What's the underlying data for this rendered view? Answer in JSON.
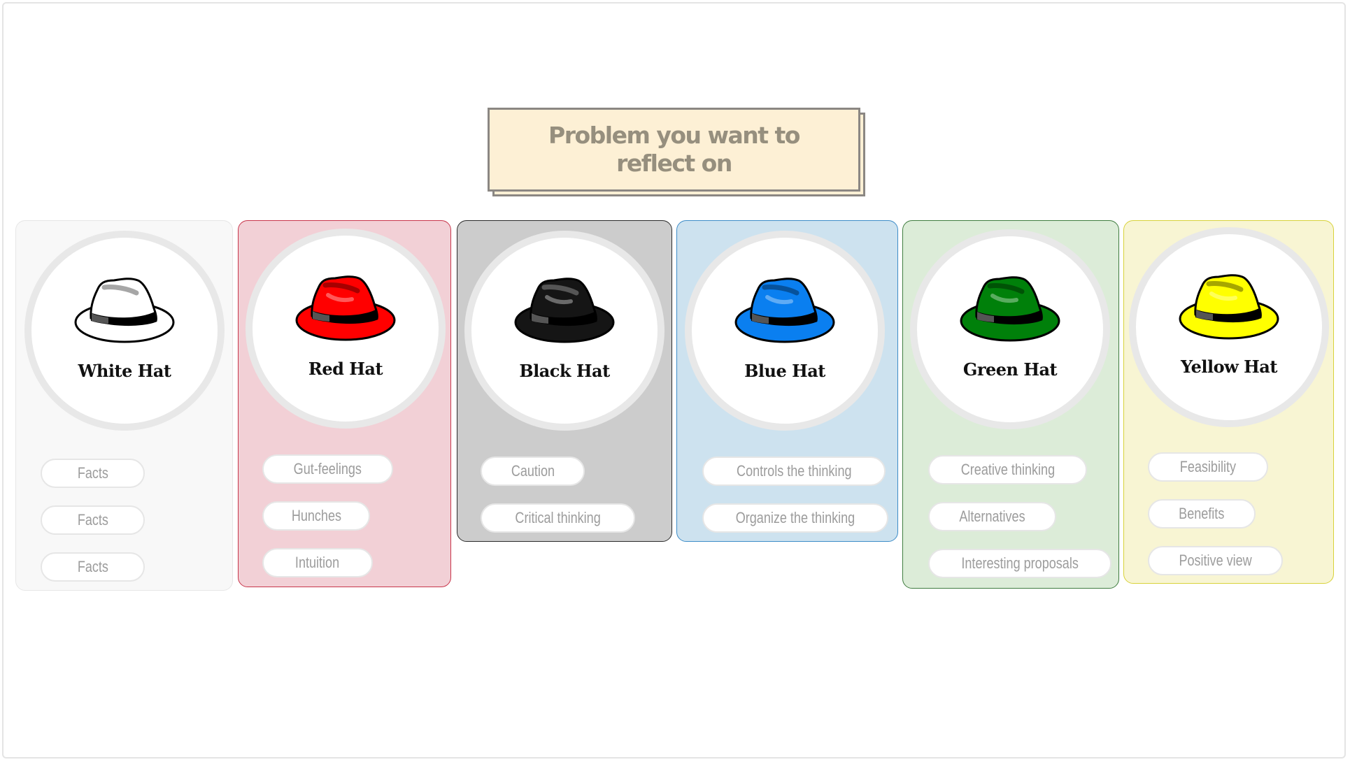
{
  "title": "Problem you want to reflect on",
  "colors": {
    "frame_border": "#e4e4e4",
    "title_fill": "#fdf0d5",
    "title_border": "#8b8783",
    "title_text": "#968f7e",
    "pill_text": "#9c9c9c"
  },
  "hats": [
    {
      "label": "White Hat",
      "icon": "white-hat-icon",
      "hat_color": "#ffffff",
      "card_bg": "#f8f8f8",
      "card_border": "#e6e6e6",
      "items": [
        "Facts",
        "Facts",
        "Facts"
      ]
    },
    {
      "label": "Red Hat",
      "icon": "red-hat-icon",
      "hat_color": "#ff0000",
      "card_bg": "#f2d0d6",
      "card_border": "#c8354b",
      "items": [
        "Gut-feelings",
        "Hunches",
        "Intuition"
      ]
    },
    {
      "label": "Black Hat",
      "icon": "black-hat-icon",
      "hat_color": "#151515",
      "card_bg": "#cccccc",
      "card_border": "#2b2b2b",
      "items": [
        "Caution",
        "Critical thinking"
      ]
    },
    {
      "label": "Blue Hat",
      "icon": "blue-hat-icon",
      "hat_color": "#0a7ff0",
      "card_bg": "#cde2ef",
      "card_border": "#3d8cc8",
      "items": [
        "Controls the thinking",
        "Organize the thinking"
      ]
    },
    {
      "label": "Green Hat",
      "icon": "green-hat-icon",
      "hat_color": "#00800a",
      "card_bg": "#dcecd8",
      "card_border": "#3f7c3f",
      "items": [
        "Creative thinking",
        "Alternatives",
        "Interesting proposals"
      ]
    },
    {
      "label": "Yellow Hat",
      "icon": "yellow-hat-icon",
      "hat_color": "#ffff00",
      "card_bg": "#f8f5d3",
      "card_border": "#d8d23a",
      "items": [
        "Feasibility",
        "Benefits",
        "Positive view"
      ]
    }
  ]
}
